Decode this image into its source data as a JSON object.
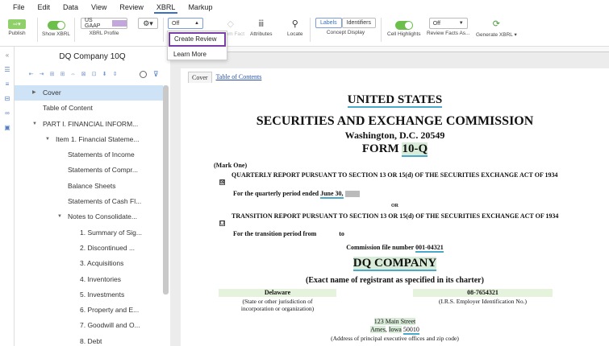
{
  "menu": [
    "File",
    "Edit",
    "Data",
    "View",
    "Review",
    "XBRL",
    "Markup"
  ],
  "toolbar": {
    "publish": "Publish",
    "show_xbrl": "Show XBRL",
    "profile_value": "US GAAP",
    "xbrl_profile": "XBRL Profile",
    "review_select": "Off",
    "item_fact": "Item Fact",
    "attributes": "Attributes",
    "locate": "Locate",
    "labels": "Labels",
    "identifiers": "Identifiers",
    "concept_display": "Concept Display",
    "cell_highlights": "Cell Highlights",
    "review_facts_value": "Off",
    "review_facts": "Review Facts As...",
    "generate_xbrl": "Generate XBRL"
  },
  "dropdown": {
    "create_review": "Create Review",
    "learn_more": "Learn More"
  },
  "sidebar": {
    "title": "DQ Company 10Q",
    "items": [
      {
        "label": "Cover",
        "level": 1,
        "caret": "right",
        "selected": true
      },
      {
        "label": "Table of Content",
        "level": 1
      },
      {
        "label": "PART I. FINANCIAL INFORM...",
        "level": 1,
        "caret": "down"
      },
      {
        "label": "Item 1. Financial Stateme...",
        "level": 2,
        "caret": "down"
      },
      {
        "label": "Statements of Income",
        "level": 3
      },
      {
        "label": "Statements of Compr...",
        "level": 3
      },
      {
        "label": "Balance Sheets",
        "level": 3
      },
      {
        "label": "Statements of Cash Fl...",
        "level": 3
      },
      {
        "label": "Notes to Consolidate...",
        "level": 3,
        "caret": "down"
      },
      {
        "label": "1. Summary of Sig...",
        "level": 4
      },
      {
        "label": "2. Discontinued ...",
        "level": 4
      },
      {
        "label": "3. Acquisitions",
        "level": 4
      },
      {
        "label": "4. Inventories",
        "level": 4
      },
      {
        "label": "5. Investments",
        "level": 4
      },
      {
        "label": "6. Property and E...",
        "level": 4
      },
      {
        "label": "7. Goodwill and O...",
        "level": 4
      },
      {
        "label": "8. Debt",
        "level": 4
      }
    ]
  },
  "doc": {
    "tab_cover": "Cover",
    "tab_toc": "Table of Contents",
    "united_states": "UNITED STATES",
    "sec": "SECURITIES AND EXCHANGE COMMISSION",
    "washington": "Washington, D.C. 20549",
    "form_label": "FORM ",
    "form_type": "10-Q",
    "mark_one": "(Mark One)",
    "quarterly_check": "☒",
    "quarterly_text": "QUARTERLY REPORT PURSUANT TO SECTION 13 OR 15(d) OF THE SECURITIES EXCHANGE ACT OF 1934",
    "quarter_period": "For the quarterly period ended ",
    "quarter_date": "June 30,",
    "or": "OR",
    "transition_check": "☐",
    "transition_text": "TRANSITION REPORT PURSUANT TO SECTION 13 OR 15(d) OF THE SECURITIES EXCHANGE ACT OF 1934",
    "transition_period": "For the transition period from",
    "to": "to",
    "commission_label": "Commission file number ",
    "commission_number": "001-04321",
    "company": "DQ COMPANY",
    "exact_name": "(Exact name of registrant as specified in its charter)",
    "state": "Delaware",
    "ein": "08-7654321",
    "state_caption": "(State or other jurisdiction of incorporation or organization)",
    "ein_caption": "(I.R.S. Employer Identification No.)",
    "street": "123 Main Street",
    "city": "Ames",
    "state_short": "Iowa",
    "zip": "50010",
    "address_caption": "(Address of principal executive offices and zip code)"
  },
  "colors": {
    "accent": "#3a6fc4",
    "toggle": "#6cbf4b",
    "highlight_border": "#7a3ea8",
    "selected": "#cfe3f7"
  }
}
